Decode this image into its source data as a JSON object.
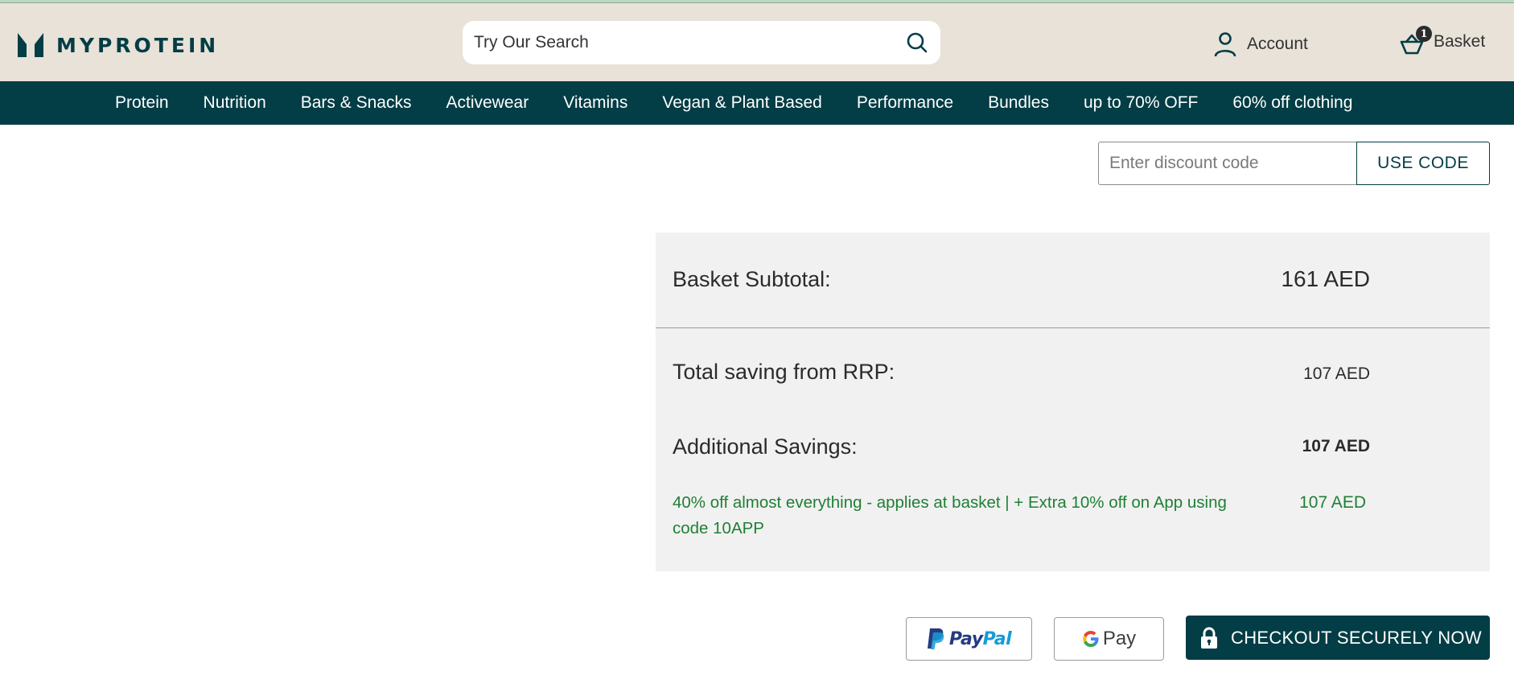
{
  "brand": {
    "name": "MYPROTEIN",
    "primary_color": "#033d45",
    "header_bg": "#e8e2d8",
    "savings_color": "#1f7f35"
  },
  "header": {
    "logo_icon": "myprotein-logo-icon",
    "search": {
      "placeholder": "Try Our Search",
      "value": "",
      "icon": "search-icon"
    },
    "account": {
      "label": "Account",
      "icon": "user-icon"
    },
    "basket": {
      "label": "Basket",
      "icon": "basket-icon",
      "count": "1"
    }
  },
  "nav": {
    "items": [
      {
        "label": "Protein"
      },
      {
        "label": "Nutrition"
      },
      {
        "label": "Bars & Snacks"
      },
      {
        "label": "Activewear"
      },
      {
        "label": "Vitamins"
      },
      {
        "label": "Vegan & Plant Based"
      },
      {
        "label": "Performance"
      },
      {
        "label": "Bundles"
      },
      {
        "label": "up to 70% OFF"
      },
      {
        "label": "60% off clothing"
      }
    ]
  },
  "discount": {
    "placeholder": "Enter discount code",
    "value": "",
    "button_label": "USE CODE"
  },
  "summary": {
    "subtotal": {
      "label": "Basket Subtotal:",
      "value": "161 AED"
    },
    "rrp_saving": {
      "label": "Total saving from RRP:",
      "value": "107 AED"
    },
    "additional_savings": {
      "label": "Additional Savings:",
      "value": "107 AED"
    },
    "promotions": [
      {
        "description": "40% off almost everything - applies at basket | + Extra 10% off on App using code 10APP",
        "value": "107 AED"
      }
    ]
  },
  "payment": {
    "paypal": {
      "label_pay": "Pay",
      "label_pal": "Pal",
      "icon": "paypal-icon"
    },
    "gpay": {
      "label": "Pay",
      "icon": "google-g-icon"
    },
    "checkout": {
      "label": "CHECKOUT SECURELY NOW",
      "icon": "lock-icon"
    }
  }
}
